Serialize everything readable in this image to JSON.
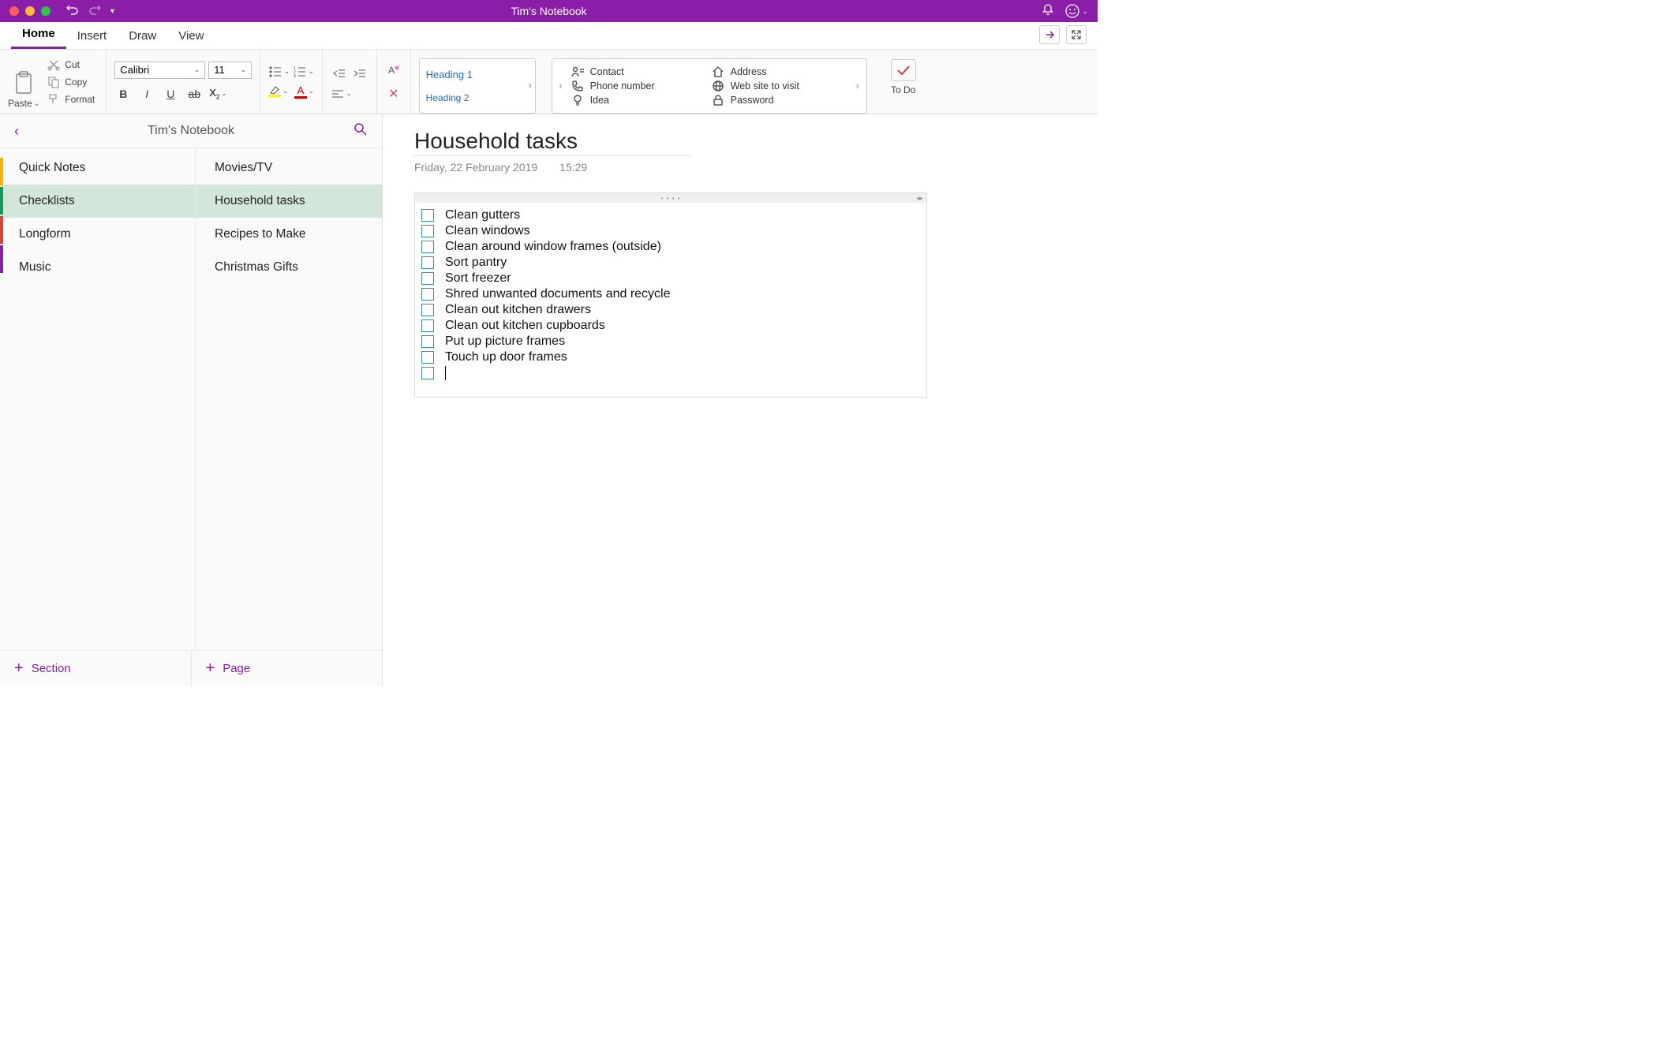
{
  "titlebar": {
    "title": "Tim's Notebook"
  },
  "tabs": {
    "home": "Home",
    "insert": "Insert",
    "draw": "Draw",
    "view": "View",
    "active": "home"
  },
  "ribbon": {
    "paste": "Paste",
    "cut": "Cut",
    "copy": "Copy",
    "format": "Format",
    "font_name": "Calibri",
    "font_size": "11",
    "headings": {
      "h1": "Heading 1",
      "h2": "Heading 2"
    },
    "tags": {
      "col1": [
        {
          "label": "Contact"
        },
        {
          "label": "Phone number"
        },
        {
          "label": "Idea"
        }
      ],
      "col2": [
        {
          "label": "Address"
        },
        {
          "label": "Web site to visit"
        },
        {
          "label": "Password"
        }
      ]
    },
    "todo": "To Do"
  },
  "sidebar": {
    "notebook_title": "Tim's Notebook",
    "color_tabs": [
      "#f4b400",
      "#0f9d58",
      "#db4437",
      "#8a1ea8"
    ],
    "sections": [
      "Quick Notes",
      "Checklists",
      "Longform",
      "Music"
    ],
    "active_section": 1,
    "pages": [
      "Movies/TV",
      "Household tasks",
      "Recipes to Make",
      "Christmas Gifts"
    ],
    "active_page": 1,
    "add_section": "Section",
    "add_page": "Page"
  },
  "page": {
    "title": "Household tasks",
    "date": "Friday, 22 February 2019",
    "time": "15:29",
    "tasks": [
      "Clean gutters",
      "Clean windows",
      "Clean around window frames (outside)",
      "Sort pantry",
      "Sort freezer",
      "Shred unwanted documents and recycle",
      "Clean out kitchen drawers",
      "Clean out kitchen cupboards",
      "Put up picture frames",
      "Touch up door frames"
    ]
  }
}
